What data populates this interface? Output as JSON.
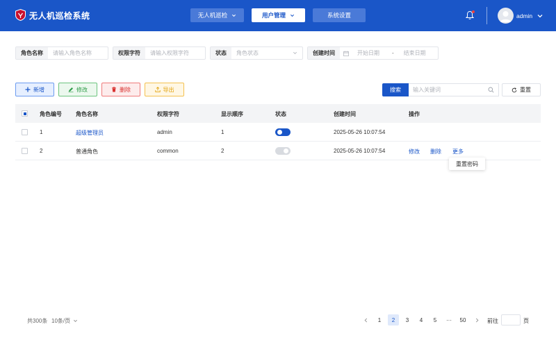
{
  "app": {
    "title": "无人机巡检系统"
  },
  "nav": {
    "items": [
      "无人机巡检",
      "用户管理",
      "系统设置"
    ]
  },
  "user": {
    "name": "admin"
  },
  "filters": {
    "role_name": {
      "label": "角色名称",
      "placeholder": "请输入角色名称"
    },
    "permission": {
      "label": "权限字符",
      "placeholder": "请输入权限字符"
    },
    "status": {
      "label": "状态",
      "placeholder": "角色状态"
    },
    "created": {
      "label": "创建时间",
      "start": "开始日期",
      "separator": "-",
      "end": "结束日期"
    }
  },
  "toolbar": {
    "add": "新增",
    "edit": "修改",
    "delete": "删除",
    "export": "导出",
    "search": "搜索",
    "search_placeholder": "输入关键词",
    "reset": "重置"
  },
  "table": {
    "columns": [
      "角色编号",
      "角色名称",
      "权限字符",
      "显示顺序",
      "状态",
      "创建时间",
      "操作"
    ],
    "rows": [
      {
        "id": "1",
        "name": "超级管理员",
        "key": "admin",
        "order": "1",
        "status_on": true,
        "created": "2025-05-26 10:07:54",
        "actions": []
      },
      {
        "id": "2",
        "name": "普通角色",
        "key": "common",
        "order": "2",
        "status_on": false,
        "created": "2025-05-26 10:07:54",
        "actions": [
          "修改",
          "删除",
          "更多"
        ]
      }
    ]
  },
  "dropdown": {
    "items": [
      "重置密码"
    ]
  },
  "pagination": {
    "total": "共300条",
    "page_size": "10条/页",
    "pages": [
      "1",
      "2",
      "3",
      "4",
      "5",
      "···",
      "50"
    ],
    "active_page": "2",
    "goto_label": "前往",
    "goto_suffix": "页"
  },
  "colors": {
    "primary": "#1a56c8",
    "header_bg": "#1a56c8",
    "danger": "#d9302f",
    "success": "#2e9c48",
    "warning": "#e2a20b"
  }
}
